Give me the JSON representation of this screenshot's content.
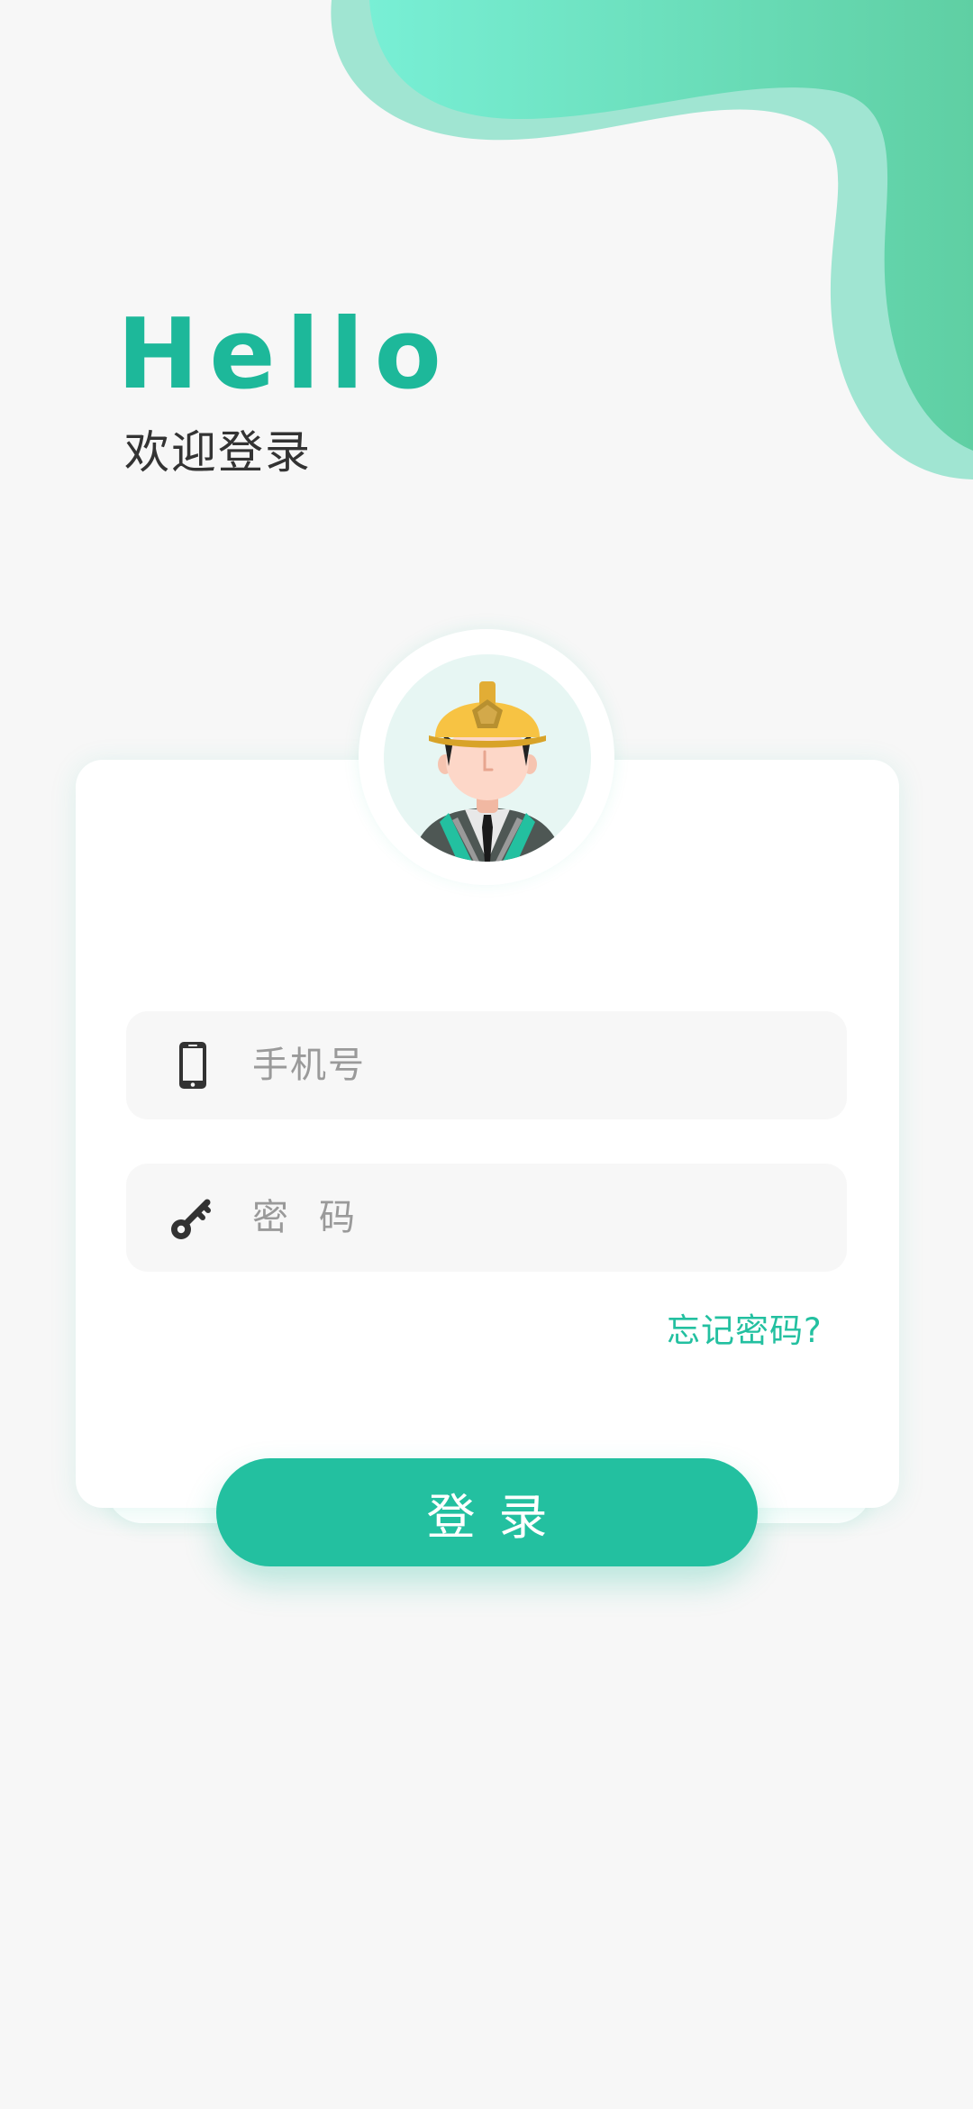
{
  "greeting": {
    "title": "Hello",
    "subtitle": "欢迎登录"
  },
  "form": {
    "phone_placeholder": "手机号",
    "password_placeholder": "密码",
    "forgot_label": "忘记密码?",
    "login_label": "登录"
  },
  "icons": {
    "phone": "phone-icon",
    "password": "key-icon",
    "avatar": "construction-worker-avatar"
  },
  "colors": {
    "brand": "#23c0a0",
    "title": "#1db89a",
    "wave_light": "#a0e5d2",
    "wave_dark_start": "#78efd5",
    "wave_dark_end": "#5fcfa3",
    "background": "#f7f7f7"
  }
}
